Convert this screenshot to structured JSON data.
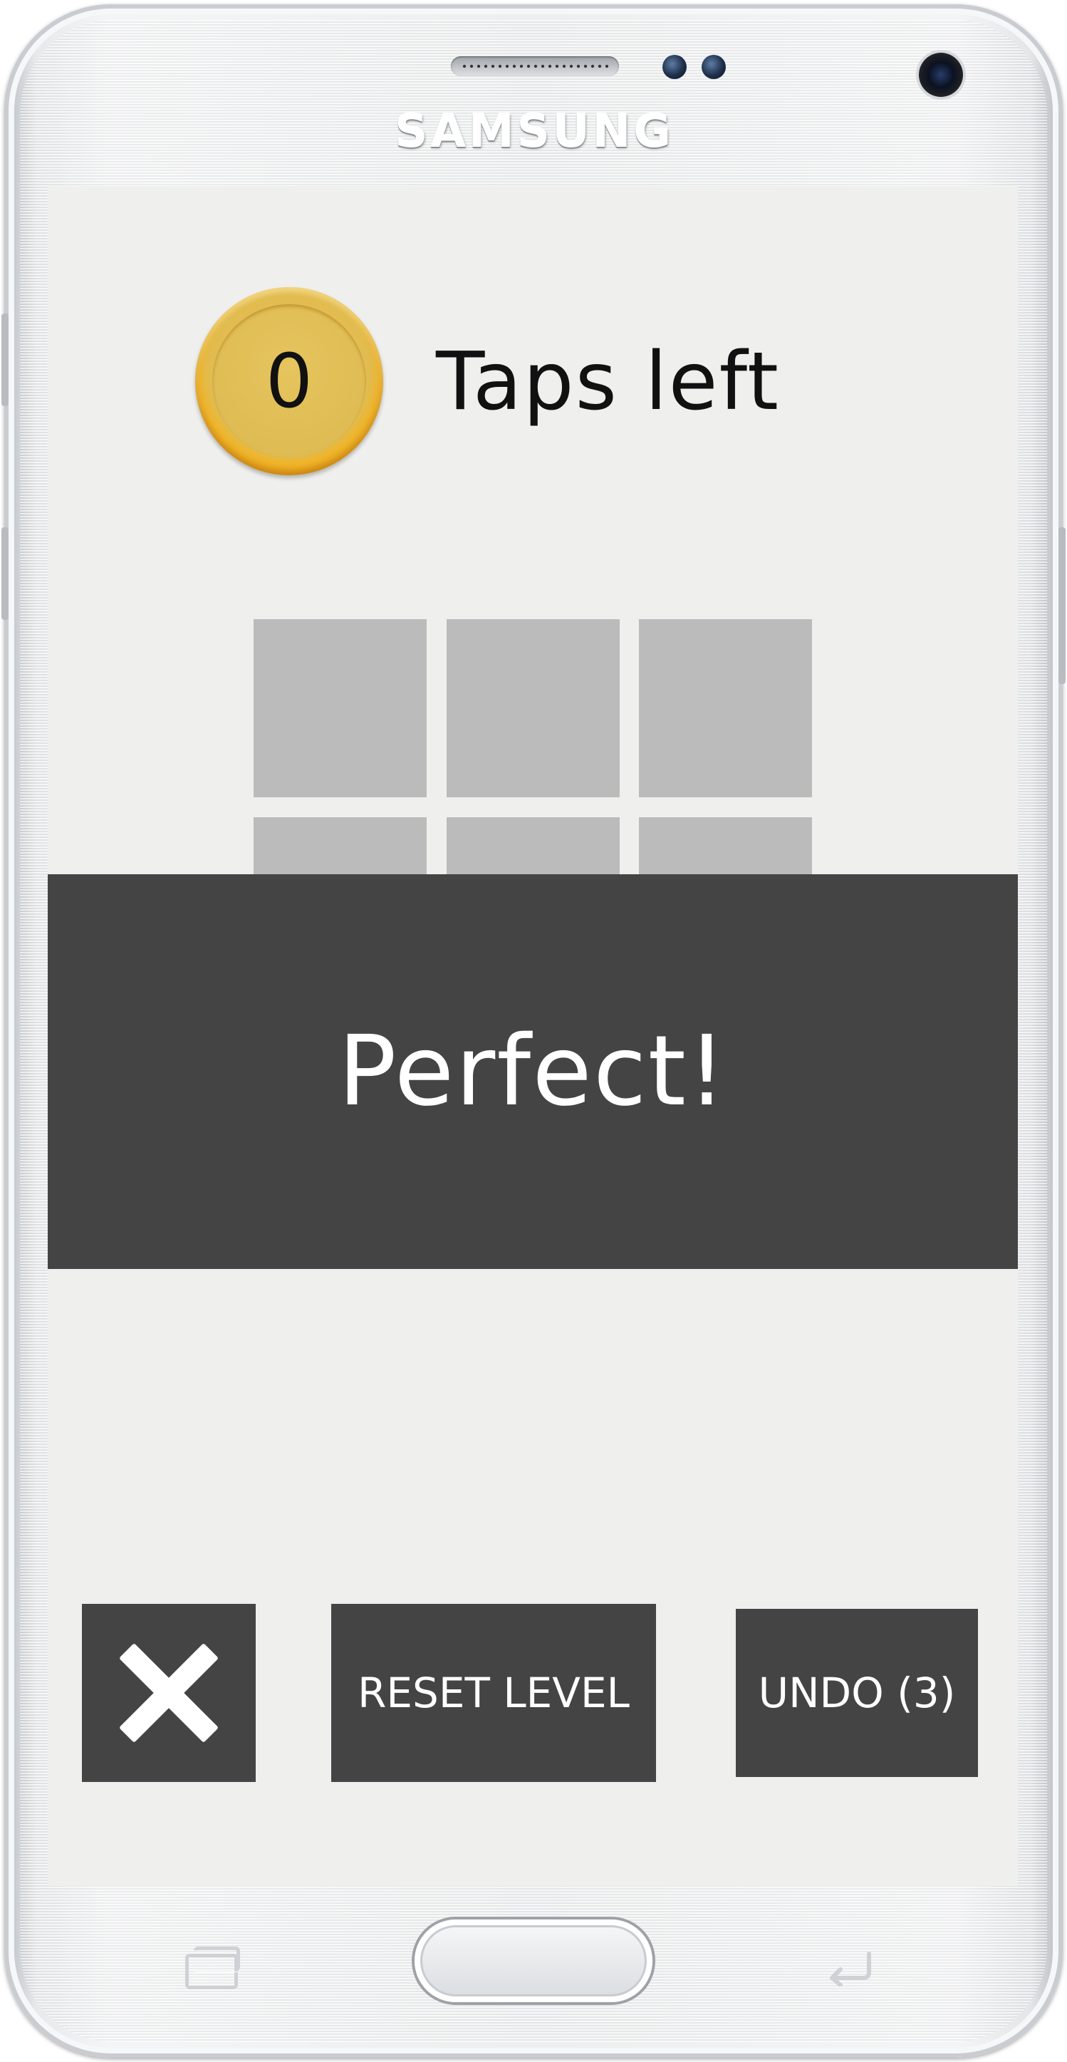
{
  "device": {
    "brand": "SAMSUNG"
  },
  "game": {
    "taps_left_count": "0",
    "taps_left_label": "Taps left",
    "banner_text": "Perfect!",
    "tile_color": "#bbbbbb",
    "tile_rows_visible": 2,
    "tile_columns": 3
  },
  "controls": {
    "close_icon": "close-icon",
    "reset_label": "RESET LEVEL",
    "undo_label": "UNDO (3)"
  },
  "nav_bar": {
    "recent_icon": "recent-apps-icon",
    "home_button": "home-button",
    "back_icon": "back-icon"
  },
  "colors": {
    "screen_bg": "#eff0ee",
    "dark": "#444444",
    "coin": "#e2bd50"
  }
}
